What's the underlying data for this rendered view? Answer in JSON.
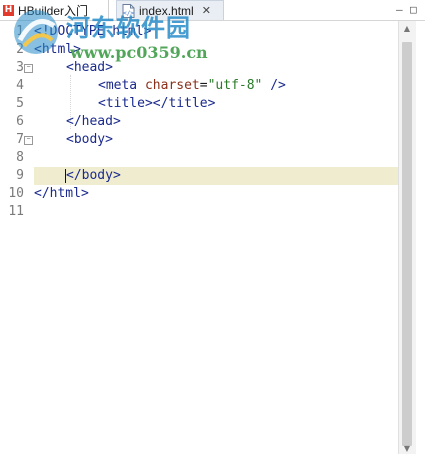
{
  "tabs": [
    {
      "label": "HBuilder入门",
      "icon": "hbuilder-logo-icon"
    },
    {
      "label": "index.html",
      "icon": "html-file-icon",
      "close": "✕"
    }
  ],
  "window_controls": {
    "minimize": "–",
    "maximize": "□"
  },
  "watermark": {
    "title": "河东软件园",
    "url": "www.pc0359.cn"
  },
  "editor": {
    "current_line": 9,
    "lines": [
      {
        "n": "1",
        "text": "<!DOCTYPE html>"
      },
      {
        "n": "2",
        "text": "<html>"
      },
      {
        "n": "3",
        "text": "<head>"
      },
      {
        "n": "4",
        "text": "<meta charset=\"utf-8\" />"
      },
      {
        "n": "5",
        "text": "<title></title>"
      },
      {
        "n": "6",
        "text": "</head>"
      },
      {
        "n": "7",
        "text": "<body>"
      },
      {
        "n": "8",
        "text": ""
      },
      {
        "n": "9",
        "text": "</body>"
      },
      {
        "n": "10",
        "text": "</html>"
      },
      {
        "n": "11",
        "text": ""
      }
    ]
  },
  "colors": {
    "tag": "#1a2a8c",
    "attr": "#8a2f1a",
    "string": "#2a7a2a",
    "current_line": "#f0ecd0",
    "watermark": "#288cc8"
  }
}
